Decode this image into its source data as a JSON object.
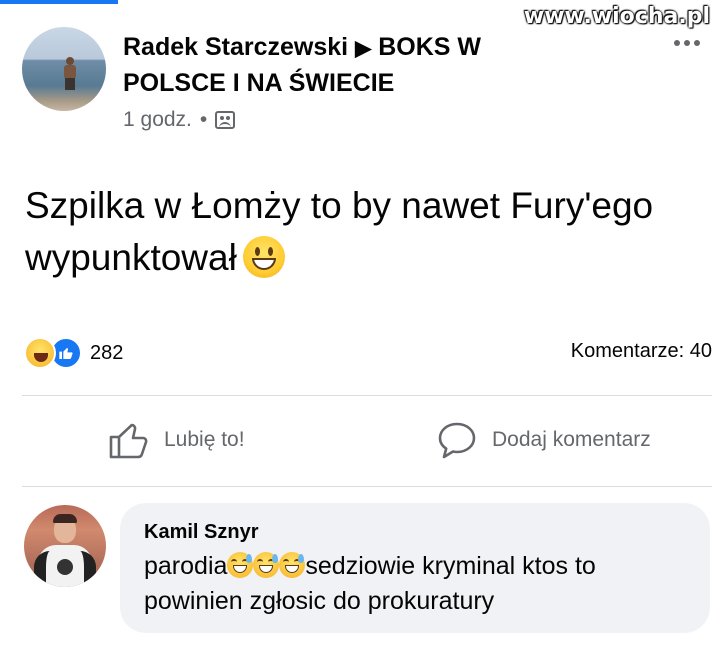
{
  "post": {
    "author": "Radek Starczewski",
    "arrow": "▶",
    "group": "BOKS W POLSCE I NA ŚWIECIE",
    "time": "1 godz.",
    "separator": "•",
    "audience_icon": "group-icon",
    "more_icon": "more-dots-icon",
    "text": "Szpilka w Łomży to by nawet Fury'ego wypunktował",
    "emoji": "grinning-face-emoji"
  },
  "stats": {
    "reaction_icons": [
      "haha-reaction-icon",
      "like-reaction-icon"
    ],
    "reaction_count": "282",
    "comments_label": "Komentarze: 40"
  },
  "actions": {
    "like_label": "Lubię to!",
    "like_icon": "thumbs-up-icon",
    "comment_label": "Dodaj komentarz",
    "comment_icon": "speech-bubble-icon"
  },
  "comment": {
    "author": "Kamil Sznyr",
    "text_start": "parodia",
    "text_end": "sedziowie  kryminal ktos to powinien zgłosic do prokuratury",
    "emoji": "grinning-sweat-emoji",
    "emoji_count": 3
  },
  "watermark": "www.wiocha.pl",
  "colors": {
    "accent": "#1877f2",
    "secondary_text": "#65676b",
    "comment_bubble": "#f0f2f5"
  }
}
